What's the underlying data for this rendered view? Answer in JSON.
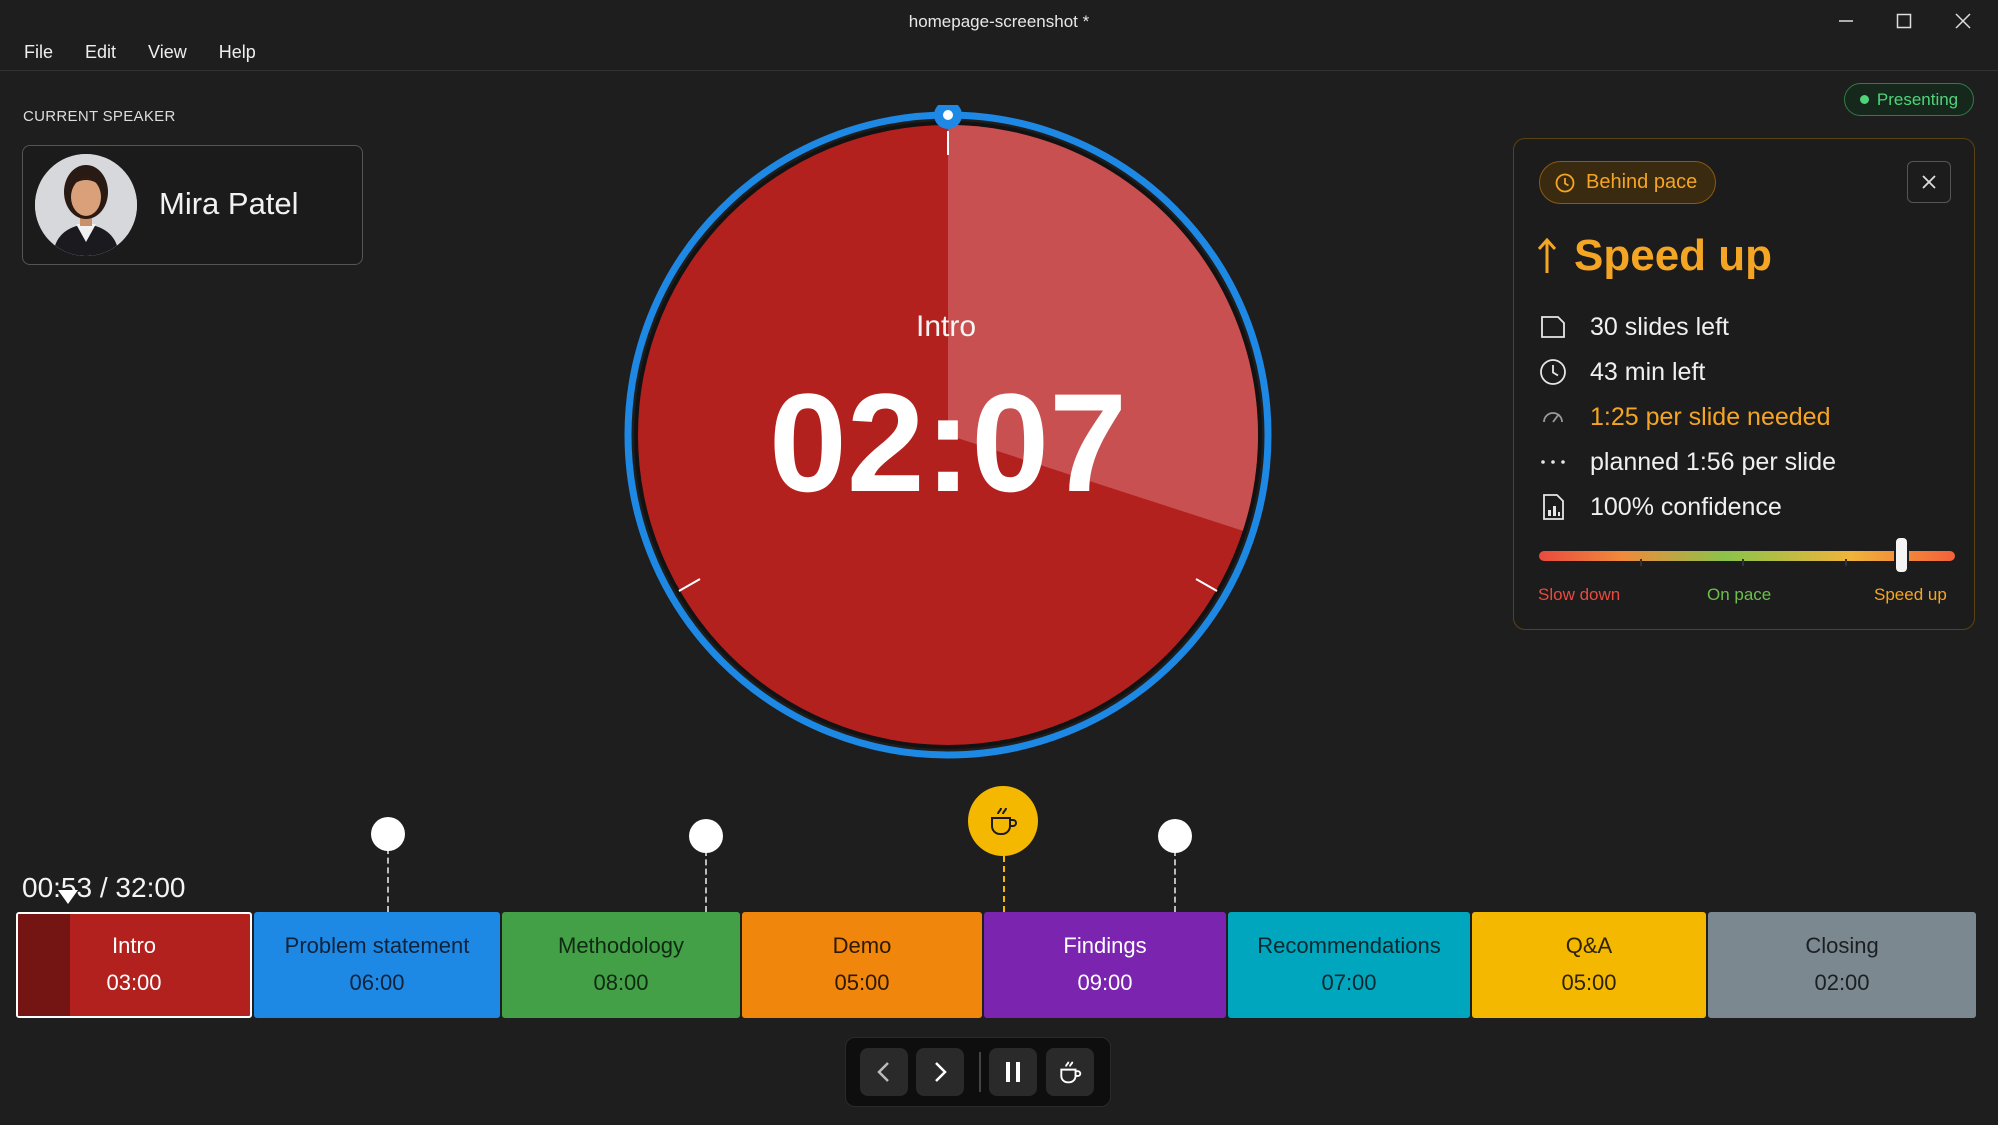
{
  "window": {
    "title": "homepage-screenshot *"
  },
  "menu": [
    "File",
    "Edit",
    "View",
    "Help"
  ],
  "status": {
    "label": "Presenting",
    "color": "#4fd47a"
  },
  "speaker": {
    "heading": "CURRENT SPEAKER",
    "name": "Mira Patel"
  },
  "timer": {
    "section": "Intro",
    "remaining": "02:07",
    "elapsed_fraction": 0.3,
    "ring_color": "#1e88e5",
    "face_color": "#b3211f"
  },
  "pace_panel": {
    "badge": "Behind pace",
    "headline": "Speed up",
    "stats": [
      {
        "icon": "slides-icon",
        "text": "30 slides left"
      },
      {
        "icon": "clock-icon",
        "text": "43 min left"
      },
      {
        "icon": "gauge-icon",
        "text": "1:25 per slide needed"
      },
      {
        "icon": "dots-icon",
        "text": "planned 1:56 per slide"
      },
      {
        "icon": "chart-doc-icon",
        "text": "100% confidence"
      }
    ],
    "scale": {
      "left": "Slow down",
      "center": "On pace",
      "right": "Speed up",
      "value": 0.87
    }
  },
  "timeline": {
    "elapsed": "00:53",
    "total": "32:00",
    "segments": [
      {
        "label": "Intro",
        "time": "03:00",
        "color": "#b3211f",
        "text": "#ffffff",
        "current": true
      },
      {
        "label": "Problem statement",
        "time": "06:00",
        "color": "#1e88e5",
        "text": "#10233a"
      },
      {
        "label": "Methodology",
        "time": "08:00",
        "color": "#43a047",
        "text": "#0f2a12"
      },
      {
        "label": "Demo",
        "time": "05:00",
        "color": "#f0870c",
        "text": "#2e1800"
      },
      {
        "label": "Findings",
        "time": "09:00",
        "color": "#7b24b0",
        "text": "#ffffff"
      },
      {
        "label": "Recommendations",
        "time": "07:00",
        "color": "#00a6bd",
        "text": "#082a30"
      },
      {
        "label": "Q&A",
        "time": "05:00",
        "color": "#f5b800",
        "text": "#2e2300"
      },
      {
        "label": "Closing",
        "time": "02:00",
        "color": "#7b8890",
        "text": "#1a1f22"
      }
    ]
  }
}
